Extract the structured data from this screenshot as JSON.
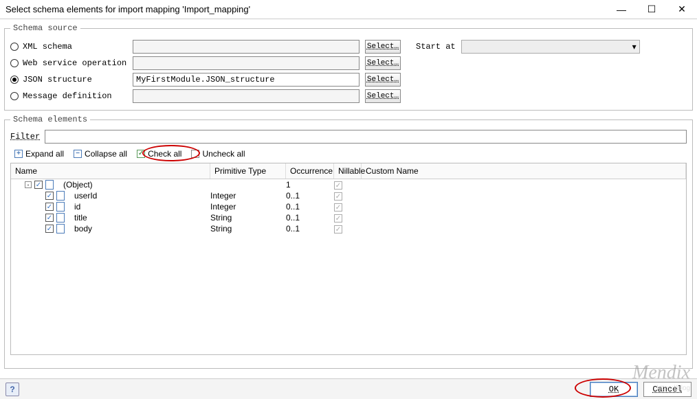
{
  "window": {
    "title": "Select schema elements for import mapping 'Import_mapping'"
  },
  "schemaSource": {
    "legend": "Schema source",
    "options": {
      "xml": {
        "label": "XML schema",
        "value": "",
        "selected": false
      },
      "ws": {
        "label": "Web service operation",
        "value": "",
        "selected": false
      },
      "json": {
        "label": "JSON structure",
        "value": "MyFirstModule.JSON_structure",
        "selected": true
      },
      "msg": {
        "label": "Message definition",
        "value": "",
        "selected": false
      }
    },
    "selectLabel": "Select…",
    "startAtLabel": "Start at",
    "startAtValue": ""
  },
  "schemaElements": {
    "legend": "Schema elements",
    "filterLabel": "Filter",
    "filterValue": "",
    "toolbar": {
      "expandAll": "Expand all",
      "collapseAll": "Collapse all",
      "checkAll": "Check all",
      "uncheckAll": "Uncheck all"
    },
    "columns": {
      "name": "Name",
      "primitive": "Primitive Type",
      "occurrence": "Occurrence",
      "nillable": "Nillable",
      "custom": "Custom Name"
    },
    "rows": [
      {
        "indent": 1,
        "expander": "-",
        "checked": true,
        "name": "(Object)",
        "primitive": "",
        "occurrence": "1",
        "nillable": true
      },
      {
        "indent": 2,
        "expander": "",
        "checked": true,
        "name": "userId",
        "primitive": "Integer",
        "occurrence": "0..1",
        "nillable": true
      },
      {
        "indent": 2,
        "expander": "",
        "checked": true,
        "name": "id",
        "primitive": "Integer",
        "occurrence": "0..1",
        "nillable": true
      },
      {
        "indent": 2,
        "expander": "",
        "checked": true,
        "name": "title",
        "primitive": "String",
        "occurrence": "0..1",
        "nillable": true
      },
      {
        "indent": 2,
        "expander": "",
        "checked": true,
        "name": "body",
        "primitive": "String",
        "occurrence": "0..1",
        "nillable": true
      }
    ]
  },
  "footer": {
    "ok": "OK",
    "cancel": "Cancel"
  },
  "watermark": {
    "big": "Mendix",
    "small": "https://blog"
  }
}
